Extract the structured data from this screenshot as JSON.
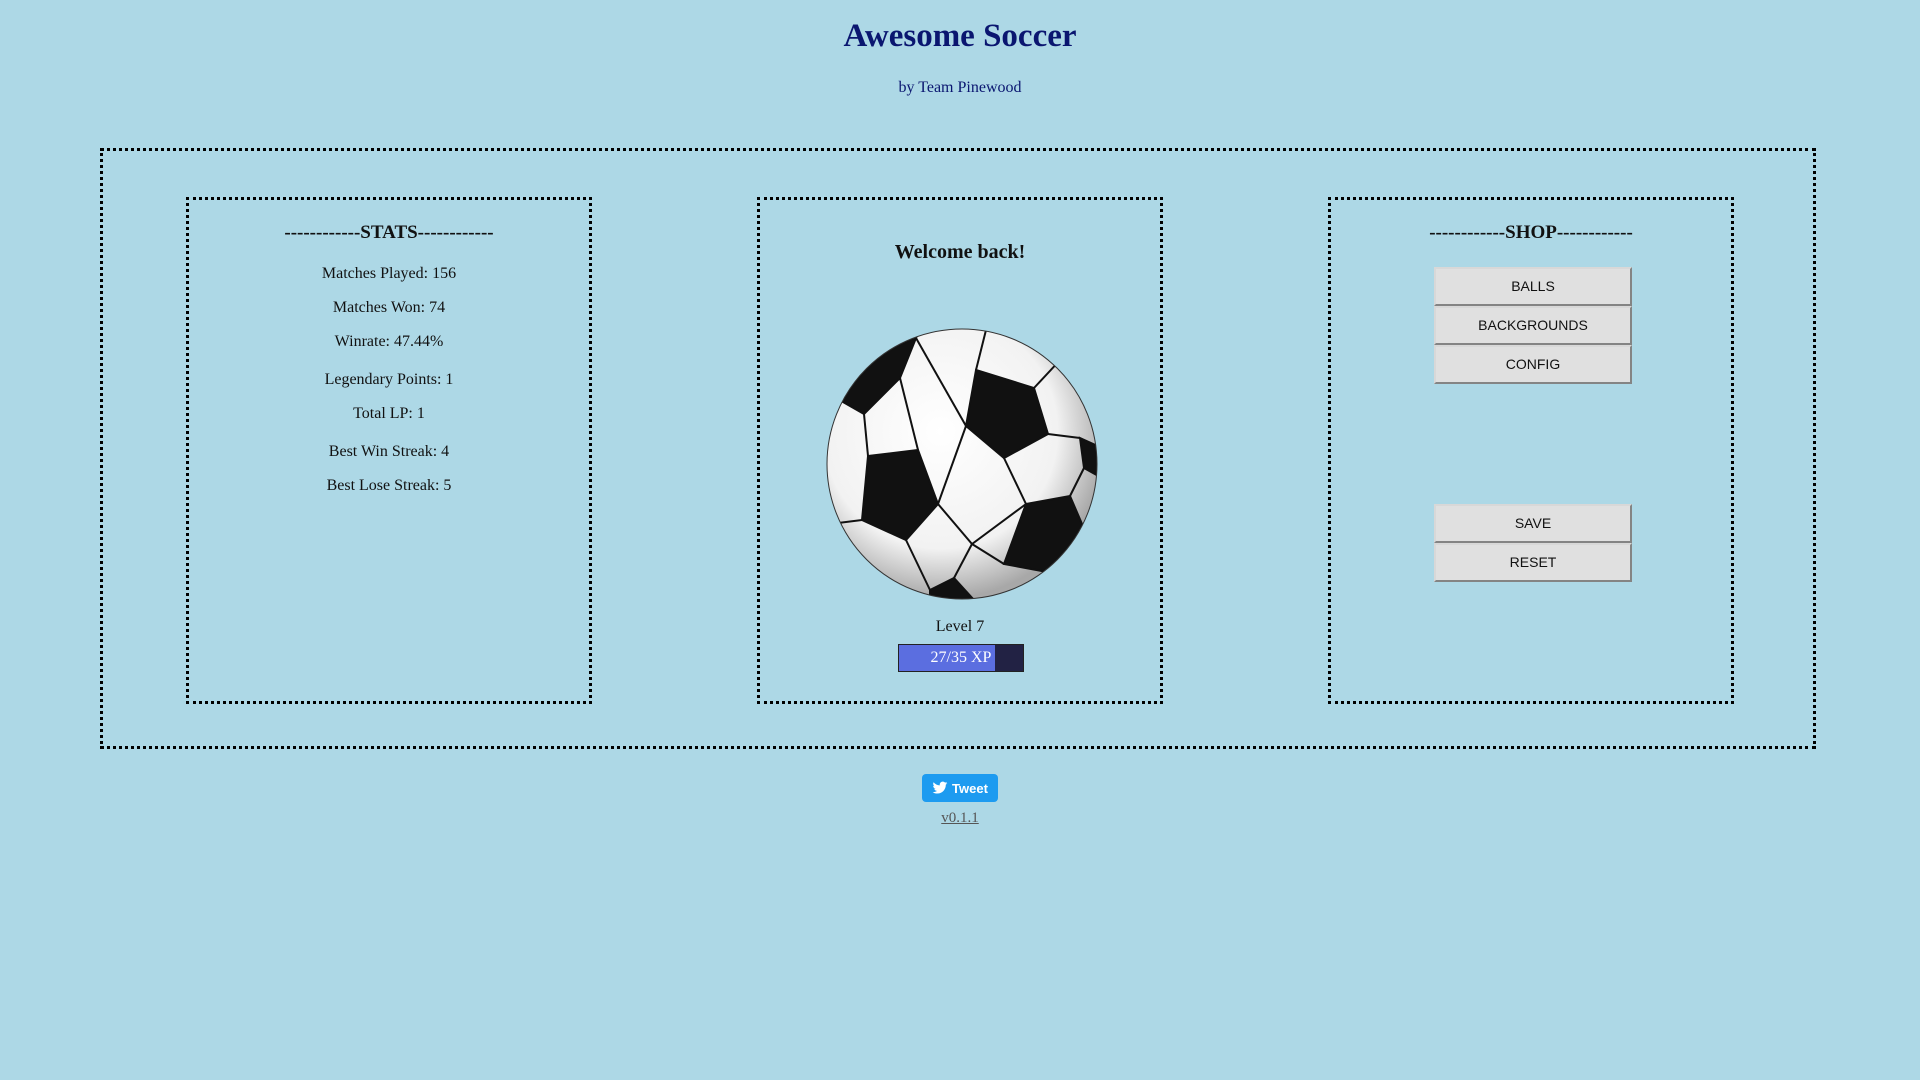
{
  "header": {
    "title": "Awesome Soccer",
    "subtitle": "by Team Pinewood"
  },
  "stats": {
    "heading": "------------STATS------------",
    "lines": [
      "Matches Played: 156",
      "Matches Won: 74",
      "Winrate: 47.44%",
      "Legendary Points: 1",
      "Total LP: 1",
      "Best Win Streak: 4",
      "Best Lose Streak: 5"
    ]
  },
  "center": {
    "welcome": "Welcome back!",
    "ball_icon": "soccer-ball-icon",
    "level_label": "Level 7",
    "xp_text": "27/35 XP",
    "xp_progress": 0.7714
  },
  "shop": {
    "heading": "------------SHOP------------",
    "buttons": [
      "BALLS",
      "BACKGROUNDS",
      "CONFIG"
    ],
    "actions": [
      "SAVE",
      "RESET"
    ]
  },
  "footer": {
    "tweet_label": "Tweet",
    "tweet_icon": "twitter-bird-icon",
    "version": "v0.1.1"
  },
  "colors": {
    "background": "#add8e6",
    "title": "#0a1670",
    "xp_fill": "#5b6ee0",
    "xp_track": "#222244",
    "tweet": "#1d9bf0"
  }
}
